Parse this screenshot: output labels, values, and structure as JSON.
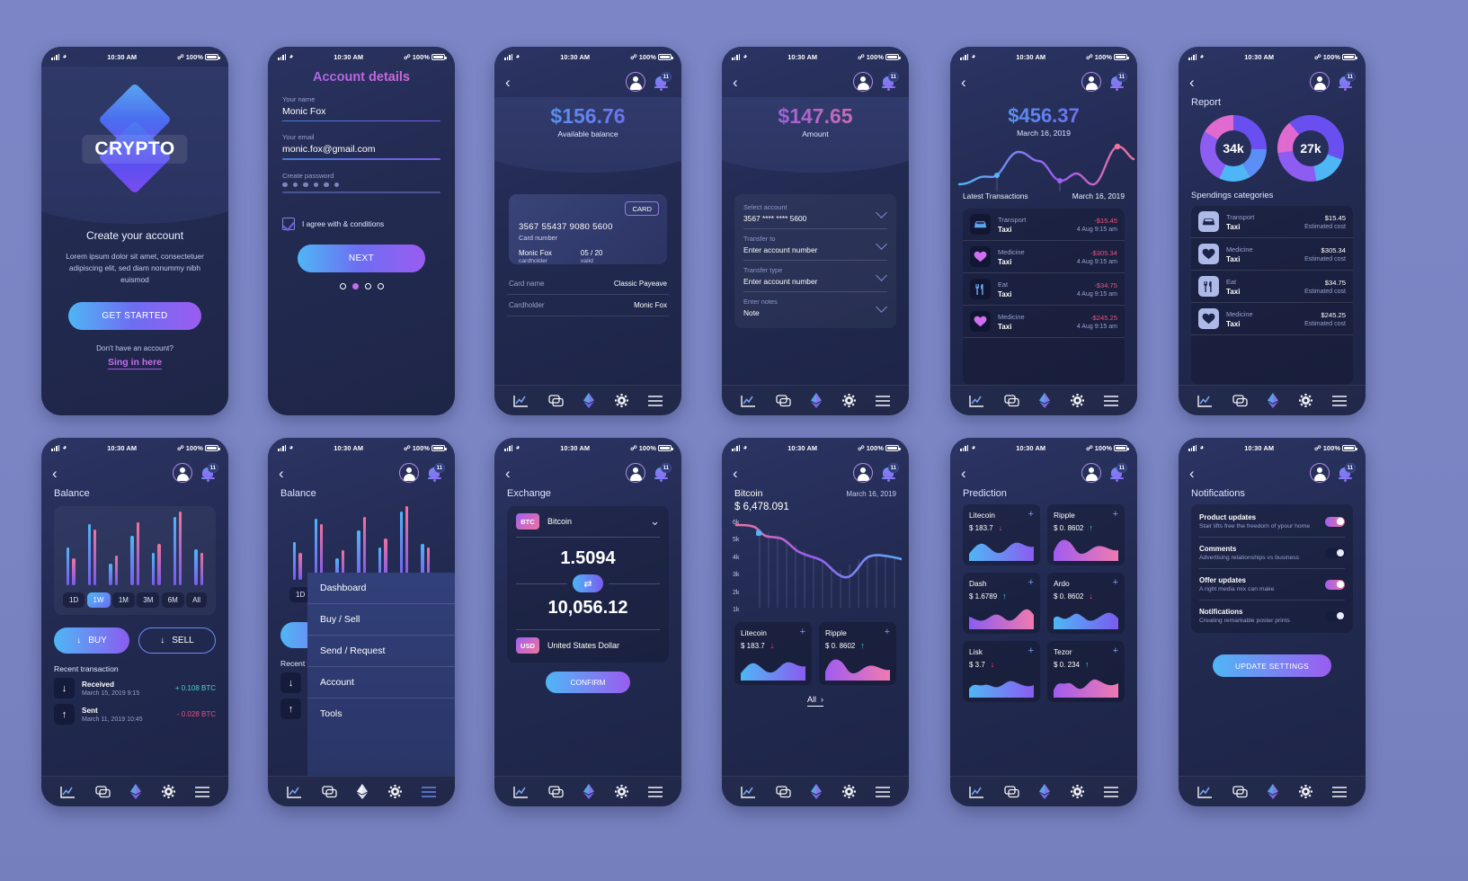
{
  "status_bar": {
    "time": "10:30 AM",
    "battery": "100%"
  },
  "common": {
    "notification_badge": "11"
  },
  "screens": {
    "onboarding": {
      "logo": "CRYPTO",
      "heading": "Create your account",
      "body": "Lorem ipsum dolor sit amet, consectetuer adipiscing elit, sed diam nonummy nibh euismod",
      "cta": "GET STARTED",
      "foot": "Don't have an account?",
      "link": "Sing in here"
    },
    "account_details": {
      "title": "Account details",
      "fields": [
        {
          "label": "Your name",
          "value": "Monic Fox"
        },
        {
          "label": "Your email",
          "value": "monic.fox@gmail.com"
        },
        {
          "label": "Create password",
          "value": "••••••"
        }
      ],
      "agree": "I agree with & conditions",
      "next": "NEXT"
    },
    "card": {
      "amount": "$156.76",
      "sub": "Available balance",
      "tag": "CARD",
      "number": "3567 55437 9080 5600",
      "number_caption": "Card number",
      "holder": "Monic Fox",
      "holder_caption": "cardholder",
      "valid": "05 / 20",
      "valid_caption": "valid",
      "rows": [
        {
          "k": "Card name",
          "v": "Classic Payeave"
        },
        {
          "k": "Cardholder",
          "v": "Monic Fox"
        }
      ]
    },
    "transfer": {
      "amount": "$147.65",
      "sub": "Amount",
      "rows": [
        {
          "label": "Select account",
          "value": "3567 **** **** 5600"
        },
        {
          "label": "Transfer to",
          "value": "Enter account number"
        },
        {
          "label": "Transfer type",
          "value": "Enter account number"
        },
        {
          "label": "Enter notes",
          "value": "Note"
        }
      ]
    },
    "transactions": {
      "amount": "$456.37",
      "date": "March 16, 2019",
      "list_title": "Latest Transactions",
      "list_date": "March 16, 2019",
      "rows": [
        {
          "icon": "car-icon",
          "cat": "Transport",
          "sub": "Taxi",
          "amt": "-$15.45",
          "date": "4 Aug  9:15 am"
        },
        {
          "icon": "heart-icon",
          "cat": "Medicine",
          "sub": "Taxi",
          "amt": "-$305.34",
          "date": "4 Aug  9:15 am"
        },
        {
          "icon": "cutlery-icon",
          "cat": "Eat",
          "sub": "Taxi",
          "amt": "-$34.75",
          "date": "4 Aug  9:15 am"
        },
        {
          "icon": "heart-icon",
          "cat": "Medicine",
          "sub": "Taxi",
          "amt": "-$245.25",
          "date": "4 Aug  9:15 am"
        }
      ]
    },
    "report": {
      "title": "Report",
      "donut_left": "34k",
      "donut_right": "27k",
      "section": "Spendings categories",
      "rows": [
        {
          "icon": "car-icon",
          "cat": "Transport",
          "sub": "Taxi",
          "amt": "$15.45",
          "date": "Estimated cost"
        },
        {
          "icon": "heart-icon",
          "cat": "Medicine",
          "sub": "Taxi",
          "amt": "$305.34",
          "date": "Estimated cost"
        },
        {
          "icon": "cutlery-icon",
          "cat": "Eat",
          "sub": "Taxi",
          "amt": "$34.75",
          "date": "Estimated cost"
        },
        {
          "icon": "heart-icon",
          "cat": "Medicine",
          "sub": "Taxi",
          "amt": "$245.25",
          "date": "Estimated cost"
        }
      ]
    },
    "balance": {
      "title": "Balance",
      "ranges": [
        "1D",
        "1W",
        "1M",
        "3M",
        "6M",
        "All"
      ],
      "active_range": "1W",
      "buy": "BUY",
      "sell": "SELL",
      "recent_title": "Recent transaction",
      "rows": [
        {
          "title": "Received",
          "date": "March 15, 2019 9:15",
          "value": "+ 0.108 BTC",
          "dir": "in"
        },
        {
          "title": "Sent",
          "date": "March 11, 2019 10:45",
          "value": "- 0.028 BTC",
          "dir": "out"
        }
      ]
    },
    "menu": {
      "title": "Balance",
      "items": [
        "Dashboard",
        "Buy / Sell",
        "Send / Request",
        "Account",
        "Tools"
      ]
    },
    "exchange": {
      "title": "Exchange",
      "from_ticker": "BTC",
      "from_name": "Bitcoin",
      "from_value": "1.5094",
      "to_value": "10,056.12",
      "to_ticker": "USD",
      "to_name": "United States Dollar",
      "confirm": "CONFIRM"
    },
    "bitcoin": {
      "name": "Bitcoin",
      "date": "March 16, 2019",
      "price": "$ 6,478.091",
      "y_ticks": [
        "6k",
        "5k",
        "4k",
        "3k",
        "2k",
        "1k"
      ],
      "coins": [
        {
          "name": "Litecoin",
          "price": "$ 183.7",
          "dir": "down"
        },
        {
          "name": "Ripple",
          "price": "$ 0. 8602",
          "dir": "up"
        }
      ],
      "all": "All"
    },
    "prediction": {
      "title": "Prediction",
      "coins": [
        {
          "name": "Litecoin",
          "price": "$ 183.7",
          "dir": "down"
        },
        {
          "name": "Ripple",
          "price": "$ 0. 8602",
          "dir": "up"
        },
        {
          "name": "Dash",
          "price": "$ 1.6789",
          "dir": "up"
        },
        {
          "name": "Ardo",
          "price": "$ 0. 8602",
          "dir": "down"
        },
        {
          "name": "Lisk",
          "price": "$ 3.7",
          "dir": "down"
        },
        {
          "name": "Tezor",
          "price": "$ 0. 234",
          "dir": "up"
        }
      ]
    },
    "notifications": {
      "title": "Notifications",
      "rows": [
        {
          "title": "Product updates",
          "sub": "Stair lifts free the freedom of ypour home",
          "on": true
        },
        {
          "title": "Comments",
          "sub": "Advertising relationships vs business",
          "on": false
        },
        {
          "title": "Offer updates",
          "sub": "A right media mix can make",
          "on": true
        },
        {
          "title": "Notifications",
          "sub": "Creating remarkable poster prints",
          "on": false
        }
      ],
      "cta": "UPDATE SETTINGS"
    }
  },
  "bottom_nav": [
    "chart-line-icon",
    "cards-icon",
    "ethereum-icon",
    "gear-icon",
    "menu-icon"
  ],
  "chart_data": [
    {
      "type": "bar",
      "title": "Balance",
      "categories": [
        "1",
        "2",
        "3",
        "4",
        "5",
        "6",
        "7",
        "8",
        "9",
        "10",
        "11",
        "12"
      ],
      "series": [
        {
          "name": "blue",
          "values": [
            42,
            68,
            24,
            55,
            36,
            82,
            40
          ]
        },
        {
          "name": "pink",
          "values": [
            30,
            62,
            33,
            70,
            46,
            88,
            36
          ]
        }
      ],
      "xlabel": "",
      "ylabel": "",
      "grid": false,
      "legend": "none"
    },
    {
      "type": "line",
      "title": "Latest Transactions",
      "x": [
        0,
        1,
        2,
        3,
        4,
        5,
        6,
        7,
        8,
        9,
        10
      ],
      "values": [
        10,
        18,
        30,
        62,
        55,
        58,
        30,
        22,
        40,
        78,
        52
      ],
      "ylabel": "",
      "grid": false,
      "legend": "none"
    },
    {
      "type": "line",
      "title": "Bitcoin",
      "ylim": [
        1000,
        6500
      ],
      "y_ticks": [
        6000,
        5000,
        4000,
        3000,
        2000,
        1000
      ],
      "x": [
        0,
        1,
        2,
        3,
        4,
        5,
        6,
        7,
        8,
        9,
        10,
        11,
        12
      ],
      "values": [
        6478,
        6400,
        5900,
        5500,
        5100,
        4700,
        4400,
        4300,
        3800,
        4100,
        4400,
        4300,
        4200
      ],
      "grid": true,
      "legend": "none"
    },
    {
      "type": "pie",
      "title": "Report",
      "charts": [
        {
          "label": "34k",
          "slices": [
            45,
            22,
            18,
            15
          ]
        },
        {
          "label": "27k",
          "slices": [
            40,
            30,
            20,
            10
          ]
        }
      ]
    }
  ]
}
